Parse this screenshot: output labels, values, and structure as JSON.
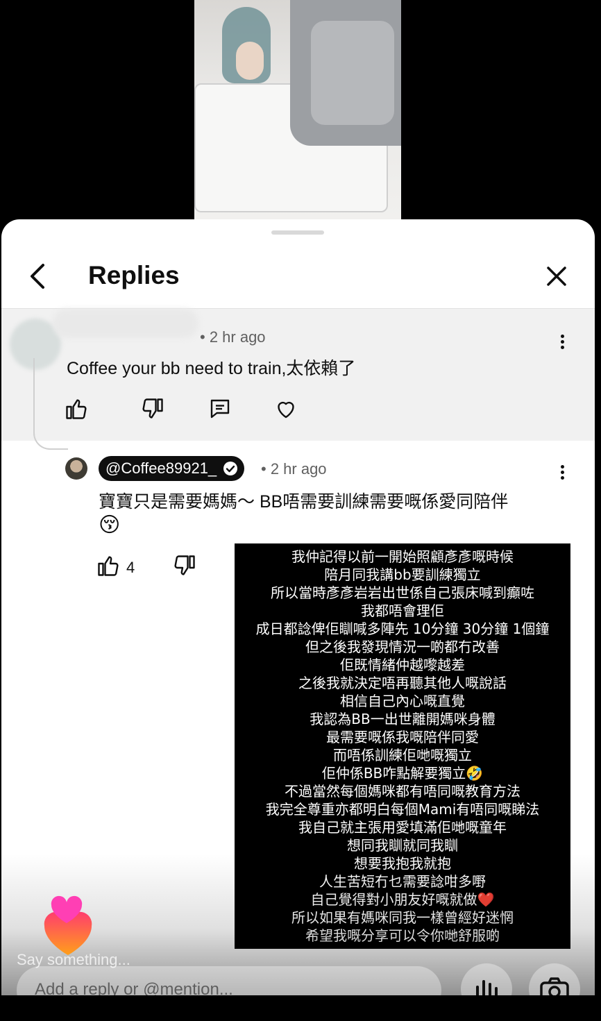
{
  "header": {
    "title": "Replies"
  },
  "parent_comment": {
    "time": "• 2 hr ago",
    "text": "Coffee your bb need to train,太依賴了"
  },
  "reply": {
    "handle": "@Coffee89921_",
    "time": "• 2 hr ago",
    "text_line1": "寶寶只是需要媽媽～ BB唔需要訓練需要嘅係愛同陪伴",
    "emoji": "😚",
    "likes": "4"
  },
  "screenshot_lines": [
    "我仲記得以前一開始照顧彥彥嘅時候",
    "陪月同我講bb要訓練獨立",
    "所以當時彥彥岩岩出世係自己張床喊到癲咗",
    "我都唔會理佢",
    "成日都諗俾佢瞓喊多陣先 10分鐘 30分鐘 1個鐘",
    "但之後我發現情況一啲都冇改善",
    "佢既情緒仲越嚟越差",
    "之後我就決定唔再聽其他人嘅說話",
    "相信自己內心嘅直覺",
    "我認為BB一出世離開媽咪身體",
    "最需要嘅係我嘅陪伴同愛",
    "而唔係訓練佢哋嘅獨立",
    "佢仲係BB咋點解要獨立🤣",
    "不過當然每個媽咪都有唔同嘅教育方法",
    "我完全尊重亦都明白每個Mami有唔同嘅睇法",
    "我自己就主張用愛填滿佢哋嘅童年",
    "想同我瞓就同我瞓",
    "想要我抱我就抱",
    "人生苦短冇乜需要諗咁多嘢",
    "自己覺得對小朋友好嘅就做❤️",
    "所以如果有媽咪同我一樣曾經好迷惘",
    "希望我嘅分享可以令你哋舒服啲"
  ],
  "footer": {
    "say_something": "Say something...",
    "reply_placeholder": "Add a reply or @mention..."
  },
  "colors": {
    "sheet_bg": "#ffffff",
    "parent_bg": "#f1f1f1",
    "chip_bg": "#0f0f0f"
  },
  "icons": [
    "back-arrow-icon",
    "close-icon",
    "more-vert-icon",
    "thumb-up-icon",
    "thumb-down-icon",
    "reply-comment-icon",
    "heart-icon",
    "verified-icon",
    "mic-icon",
    "camera-icon",
    "floating-hearts-icon"
  ]
}
